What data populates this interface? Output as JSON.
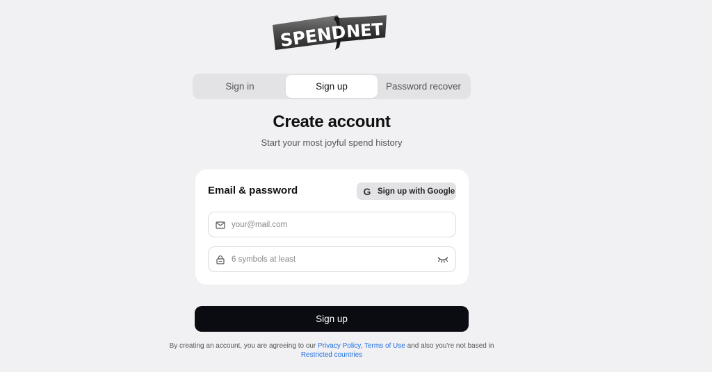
{
  "brand": {
    "logo_left": "SPEND",
    "logo_right": "NET"
  },
  "tabs": [
    {
      "label": "Sign in",
      "active": false
    },
    {
      "label": "Sign up",
      "active": true
    },
    {
      "label": "Password recover",
      "active": false
    }
  ],
  "heading": {
    "title": "Create account",
    "subtitle": "Start your most joyful spend history"
  },
  "form": {
    "section_title": "Email & password",
    "google_button": "Sign up with Google",
    "email": {
      "value": "",
      "placeholder": "your@mail.com",
      "icon": "mail-icon"
    },
    "password": {
      "value": "",
      "placeholder": "6 symbols at least",
      "icon": "lock-icon",
      "toggle_icon": "eye-closed-icon"
    },
    "submit_label": "Sign up"
  },
  "legal": {
    "prefix": "By creating an account, you are agreeing to our ",
    "privacy": "Privacy Policy",
    "comma": ", ",
    "terms": "Terms of Use",
    "middle": " and also you're not based in ",
    "restricted": "Restricted countries"
  },
  "colors": {
    "background": "#f1f1f3",
    "primary_button": "#0b0b12",
    "link": "#1f6fe0"
  }
}
